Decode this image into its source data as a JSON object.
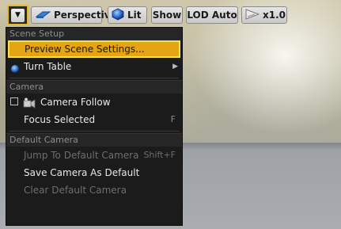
{
  "toolbar": {
    "menu_icon": "chevron-down-icon",
    "perspective_label": "Perspective",
    "lit_label": "Lit",
    "show_label": "Show",
    "lod_label": "LOD Auto",
    "speed_label": "x1.0"
  },
  "menu": {
    "scene_setup": {
      "header": "Scene Setup",
      "preview_scene_settings": "Preview Scene Settings...",
      "turn_table": "Turn Table"
    },
    "camera": {
      "header": "Camera",
      "camera_follow": "Camera Follow",
      "camera_follow_checked": false,
      "focus_selected": "Focus Selected",
      "focus_selected_shortcut": "F"
    },
    "default_camera": {
      "header": "Default Camera",
      "jump_to_default": "Jump To Default Camera",
      "jump_shortcut": "Shift+F",
      "save_as_default": "Save Camera As Default",
      "clear_default": "Clear Default Camera"
    }
  },
  "colors": {
    "highlight": "#e4a413",
    "highlight_border": "#f4e24a",
    "menu_bg": "#1b1b1b"
  }
}
